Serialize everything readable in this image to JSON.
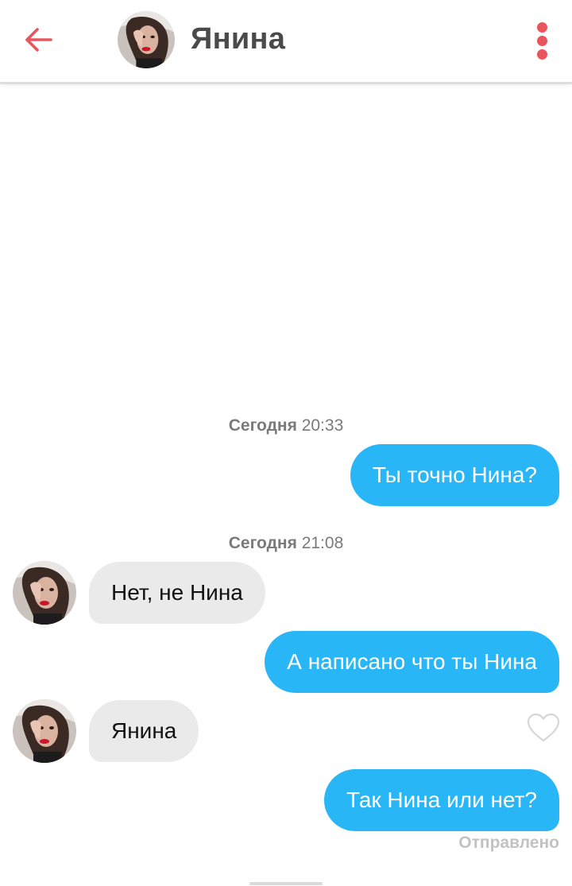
{
  "header": {
    "contact_name": "Янина",
    "back_icon": "arrow-left-icon",
    "menu_icon": "more-vertical-icon"
  },
  "messages": [
    {
      "type": "timestamp",
      "day": "Сегодня",
      "time": "20:33"
    },
    {
      "type": "outgoing",
      "text": "Ты точно Нина?"
    },
    {
      "type": "timestamp",
      "day": "Сегодня",
      "time": "21:08"
    },
    {
      "type": "incoming",
      "text": "Нет, не Нина"
    },
    {
      "type": "outgoing",
      "text": "А написано что ты Нина"
    },
    {
      "type": "incoming",
      "text": "Янина",
      "like_icon": "heart-outline-icon"
    },
    {
      "type": "outgoing",
      "text": "Так Нина или нет?"
    }
  ],
  "status_text": "Отправлено",
  "colors": {
    "accent": "#e8555c",
    "outgoing_bubble": "#29b6f6",
    "incoming_bubble": "#eaeaea",
    "status_text": "#c2c2c2"
  }
}
